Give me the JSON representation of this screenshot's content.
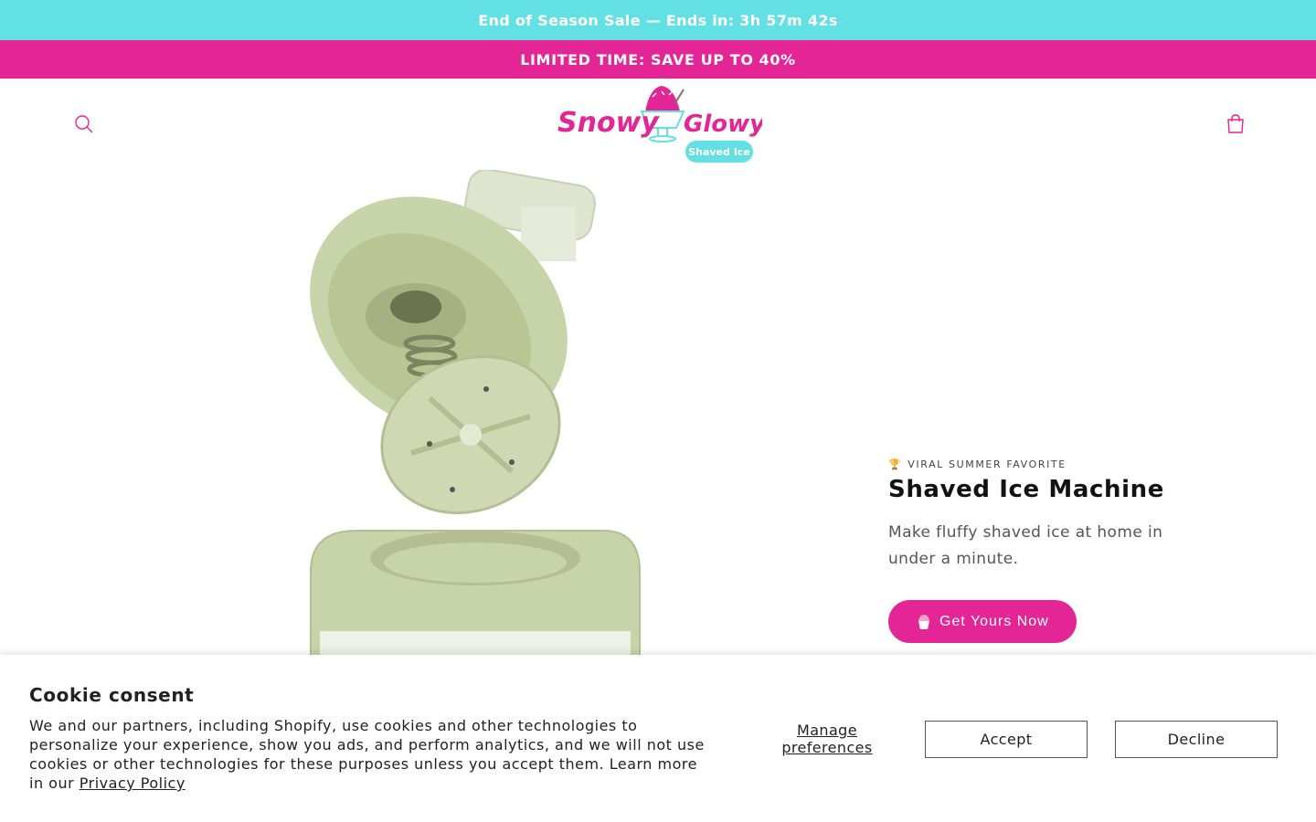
{
  "announcement": {
    "countdown_text": "End of Season Sale — Ends in: 3h 57m 42s",
    "promo_text": "LIMITED TIME: SAVE UP TO 40%"
  },
  "header": {
    "search_icon": "search-icon",
    "cart_icon": "cart-icon",
    "logo": {
      "wordmark": "Snowy Glowy",
      "tagline": "Shaved Ice"
    }
  },
  "colors": {
    "countdown_bar": "#62e0e3",
    "brand_pink": "#e42596",
    "product_green": "#c7d3a8"
  },
  "product": {
    "badge_icon": "trophy-icon",
    "badge": "VIRAL SUMMER FAVORITE",
    "title": "Shaved Ice Machine",
    "description": "Make fluffy shaved ice at home in under a minute.",
    "cta_icon": "shaved-ice-icon",
    "cta_label": "Get Yours Now"
  },
  "cookie_banner": {
    "title": "Cookie consent",
    "text": "We and our partners, including Shopify, use cookies and other technologies to personalize your experience, show you ads, and perform analytics, and we will not use cookies or other technologies for these purposes unless you accept them. Learn more in our",
    "privacy_link": "Privacy Policy",
    "manage_label": "Manage preferences",
    "accept_label": "Accept",
    "decline_label": "Decline"
  }
}
